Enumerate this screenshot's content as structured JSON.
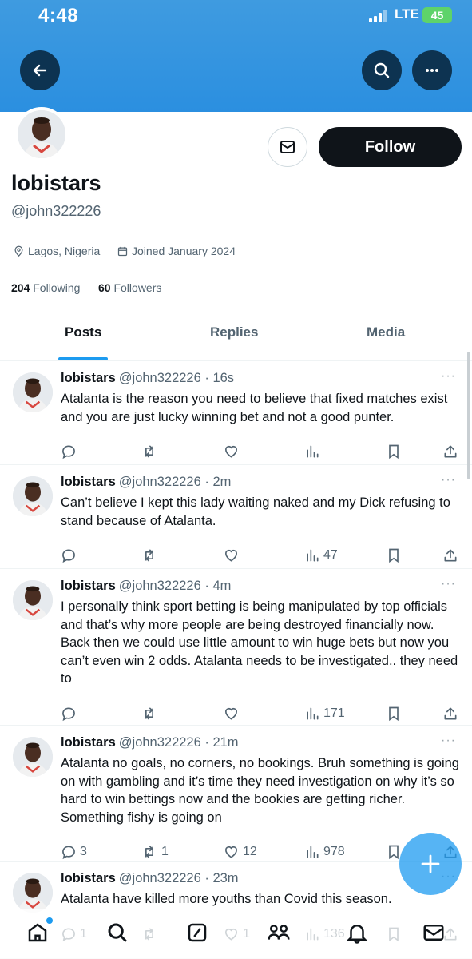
{
  "status": {
    "time": "4:48",
    "network": "LTE",
    "battery": "45"
  },
  "profile": {
    "display_name": "lobistars",
    "handle": "@john322226",
    "location": "Lagos, Nigeria",
    "joined": "Joined January 2024",
    "following_count": "204",
    "following_label": "Following",
    "followers_count": "60",
    "followers_label": "Followers"
  },
  "buttons": {
    "follow": "Follow"
  },
  "tabs": [
    {
      "label": "Posts",
      "active": true
    },
    {
      "label": "Replies",
      "active": false
    },
    {
      "label": "Media",
      "active": false
    }
  ],
  "posts": [
    {
      "name": "lobistars",
      "meta": "@john322226 · 16s",
      "text": "Atalanta is the reason you need to believe that fixed matches exist and you are just lucky winning bet and not a good punter.",
      "replies": "",
      "reposts": "",
      "likes": "",
      "views": ""
    },
    {
      "name": "lobistars",
      "meta": "@john322226 · 2m",
      "text": "Can’t believe I kept this lady waiting naked and my Dick refusing to stand because of Atalanta.",
      "replies": "",
      "reposts": "",
      "likes": "",
      "views": "47"
    },
    {
      "name": "lobistars",
      "meta": "@john322226 · 4m",
      "text": "I personally think sport betting is being manipulated by top officials and that’s why more people are being destroyed financially now. Back then we could use little amount to win huge bets but now you can’t even win 2 odds. Atalanta needs to be investigated.. they need to",
      "replies": "",
      "reposts": "",
      "likes": "",
      "views": "171"
    },
    {
      "name": "lobistars",
      "meta": "@john322226 · 21m",
      "text": "Atalanta no goals, no corners, no bookings. Bruh something is going on with gambling and it’s time they need investigation on why it’s so hard to win bettings now and the bookies are getting richer. Something fishy is going on",
      "replies": "3",
      "reposts": "1",
      "likes": "12",
      "views": "978"
    },
    {
      "name": "lobistars",
      "meta": "@john322226 · 23m",
      "text": "Atalanta have killed more youths than Covid this season.",
      "replies": "1",
      "reposts": "",
      "likes": "1",
      "views": "136"
    }
  ],
  "colors": {
    "banner": "#2b8fe0",
    "accent": "#1d9bf0",
    "text": "#0f1419",
    "muted": "#536471"
  },
  "icons": [
    "back-arrow-icon",
    "search-icon",
    "more-icon",
    "mail-icon",
    "location-icon",
    "calendar-icon",
    "reply-icon",
    "repost-icon",
    "like-icon",
    "views-icon",
    "bookmark-icon",
    "share-icon",
    "plus-icon",
    "home-icon",
    "explore-icon",
    "grok-icon",
    "communities-icon",
    "notifications-icon",
    "messages-icon"
  ]
}
